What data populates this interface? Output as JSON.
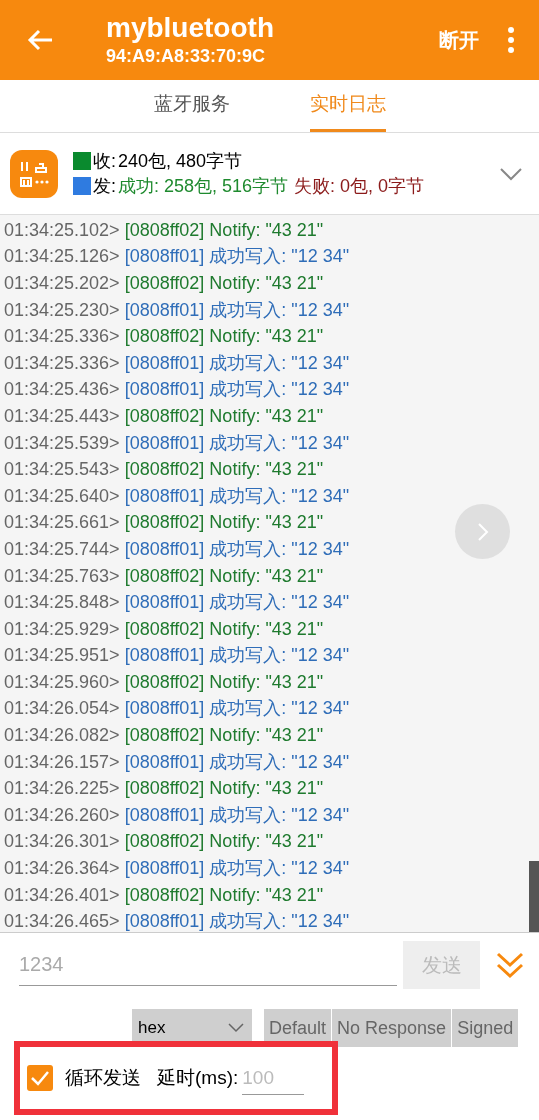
{
  "header": {
    "title": "mybluetooth",
    "subtitle": "94:A9:A8:33:70:9C",
    "action": "断开"
  },
  "tabs": [
    {
      "label": "蓝牙服务",
      "selected": false
    },
    {
      "label": "实时日志",
      "selected": true
    }
  ],
  "stats": {
    "received": {
      "color": "#0a8a2e",
      "label": "收:",
      "text": "240包, 480字节"
    },
    "sent": {
      "color": "#2f7be0",
      "label": "发:",
      "success": "成功: 258包, 516字节",
      "failure": "失败: 0包, 0字节"
    }
  },
  "log": [
    {
      "time": "01:34:25.102>",
      "kind": "notify",
      "text": "[0808ff02] Notify: \"43 21\""
    },
    {
      "time": "01:34:25.126>",
      "kind": "write",
      "text": "[0808ff01] 成功写入: \"12 34\""
    },
    {
      "time": "01:34:25.202>",
      "kind": "notify",
      "text": "[0808ff02] Notify: \"43 21\""
    },
    {
      "time": "01:34:25.230>",
      "kind": "write",
      "text": "[0808ff01] 成功写入: \"12 34\""
    },
    {
      "time": "01:34:25.336>",
      "kind": "notify",
      "text": "[0808ff02] Notify: \"43 21\""
    },
    {
      "time": "01:34:25.336>",
      "kind": "write",
      "text": "[0808ff01] 成功写入: \"12 34\""
    },
    {
      "time": "01:34:25.436>",
      "kind": "write",
      "text": "[0808ff01] 成功写入: \"12 34\""
    },
    {
      "time": "01:34:25.443>",
      "kind": "notify",
      "text": "[0808ff02] Notify: \"43 21\""
    },
    {
      "time": "01:34:25.539>",
      "kind": "write",
      "text": "[0808ff01] 成功写入: \"12 34\""
    },
    {
      "time": "01:34:25.543>",
      "kind": "notify",
      "text": "[0808ff02] Notify: \"43 21\""
    },
    {
      "time": "01:34:25.640>",
      "kind": "write",
      "text": "[0808ff01] 成功写入: \"12 34\""
    },
    {
      "time": "01:34:25.661>",
      "kind": "notify",
      "text": "[0808ff02] Notify: \"43 21\""
    },
    {
      "time": "01:34:25.744>",
      "kind": "write",
      "text": "[0808ff01] 成功写入: \"12 34\""
    },
    {
      "time": "01:34:25.763>",
      "kind": "notify",
      "text": "[0808ff02] Notify: \"43 21\""
    },
    {
      "time": "01:34:25.848>",
      "kind": "write",
      "text": "[0808ff01] 成功写入: \"12 34\""
    },
    {
      "time": "01:34:25.929>",
      "kind": "notify",
      "text": "[0808ff02] Notify: \"43 21\""
    },
    {
      "time": "01:34:25.951>",
      "kind": "write",
      "text": "[0808ff01] 成功写入: \"12 34\""
    },
    {
      "time": "01:34:25.960>",
      "kind": "notify",
      "text": "[0808ff02] Notify: \"43 21\""
    },
    {
      "time": "01:34:26.054>",
      "kind": "write",
      "text": "[0808ff01] 成功写入: \"12 34\""
    },
    {
      "time": "01:34:26.082>",
      "kind": "notify",
      "text": "[0808ff02] Notify: \"43 21\""
    },
    {
      "time": "01:34:26.157>",
      "kind": "write",
      "text": "[0808ff01] 成功写入: \"12 34\""
    },
    {
      "time": "01:34:26.225>",
      "kind": "notify",
      "text": "[0808ff02] Notify: \"43 21\""
    },
    {
      "time": "01:34:26.260>",
      "kind": "write",
      "text": "[0808ff01] 成功写入: \"12 34\""
    },
    {
      "time": "01:34:26.301>",
      "kind": "notify",
      "text": "[0808ff02] Notify: \"43 21\""
    },
    {
      "time": "01:34:26.364>",
      "kind": "write",
      "text": "[0808ff01] 成功写入: \"12 34\""
    },
    {
      "time": "01:34:26.401>",
      "kind": "notify",
      "text": "[0808ff02] Notify: \"43 21\""
    },
    {
      "time": "01:34:26.465>",
      "kind": "write",
      "text": "[0808ff01] 成功写入: \"12 34\""
    }
  ],
  "input": {
    "placeholder": "1234",
    "send": "发送"
  },
  "format": {
    "value": "hex",
    "options": [
      {
        "label": "Default"
      },
      {
        "label": "No Response"
      },
      {
        "label": "Signed"
      }
    ]
  },
  "loop": {
    "checked": true,
    "label": "循环发送",
    "delay_label": "延时(ms):",
    "delay_placeholder": "100"
  }
}
